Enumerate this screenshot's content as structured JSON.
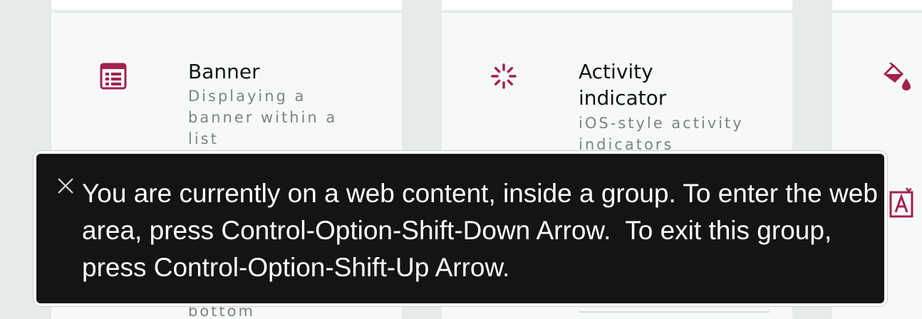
{
  "cards": [
    {
      "icon": "list-alt-icon",
      "title": "Banner",
      "description": "Displaying a banner within a list",
      "hidden_text": "bottom"
    },
    {
      "icon": "activity-spinner-icon",
      "title": "Activity indicator",
      "description": "iOS-style activity indicators"
    },
    {
      "icons": [
        "paint-bucket-icon",
        "text-style-icon"
      ]
    }
  ],
  "tooltip": {
    "text": "You are currently on a web content, inside a group. To enter the web area, press Control-Option-Shift-Down Arrow.  To exit this group, press Control-Option-Shift-Up Arrow.",
    "close_icon": "close-icon"
  },
  "colors": {
    "accent": "#a3214a",
    "page_bg": "#e6ebea",
    "card_bg": "#f7f9f9",
    "tooltip_bg": "#141414"
  }
}
